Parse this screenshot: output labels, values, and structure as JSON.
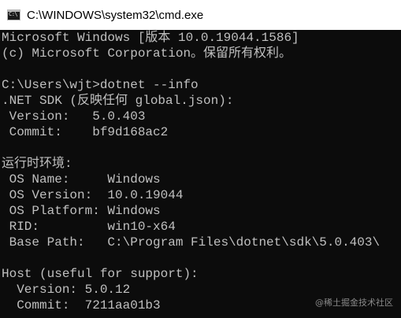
{
  "window": {
    "title": "C:\\WINDOWS\\system32\\cmd.exe",
    "icon": "cmd-icon",
    "icon_glyph": "C:\\"
  },
  "console": {
    "lines": [
      "Microsoft Windows [版本 10.0.19044.1586]",
      "(c) Microsoft Corporation。保留所有权利。",
      "",
      "C:\\Users\\wjt>dotnet --info",
      ".NET SDK (反映任何 global.json):",
      " Version:   5.0.403",
      " Commit:    bf9d168ac2",
      "",
      "运行时环境:",
      " OS Name:     Windows",
      " OS Version:  10.0.19044",
      " OS Platform: Windows",
      " RID:         win10-x64",
      " Base Path:   C:\\Program Files\\dotnet\\sdk\\5.0.403\\",
      "",
      "Host (useful for support):",
      "  Version: 5.0.12",
      "  Commit:  7211aa01b3"
    ]
  },
  "watermark": "@稀土掘金技术社区",
  "colors": {
    "console_background": "#0c0c0c",
    "console_text": "#c0c0c0",
    "titlebar_background": "#ffffff"
  }
}
